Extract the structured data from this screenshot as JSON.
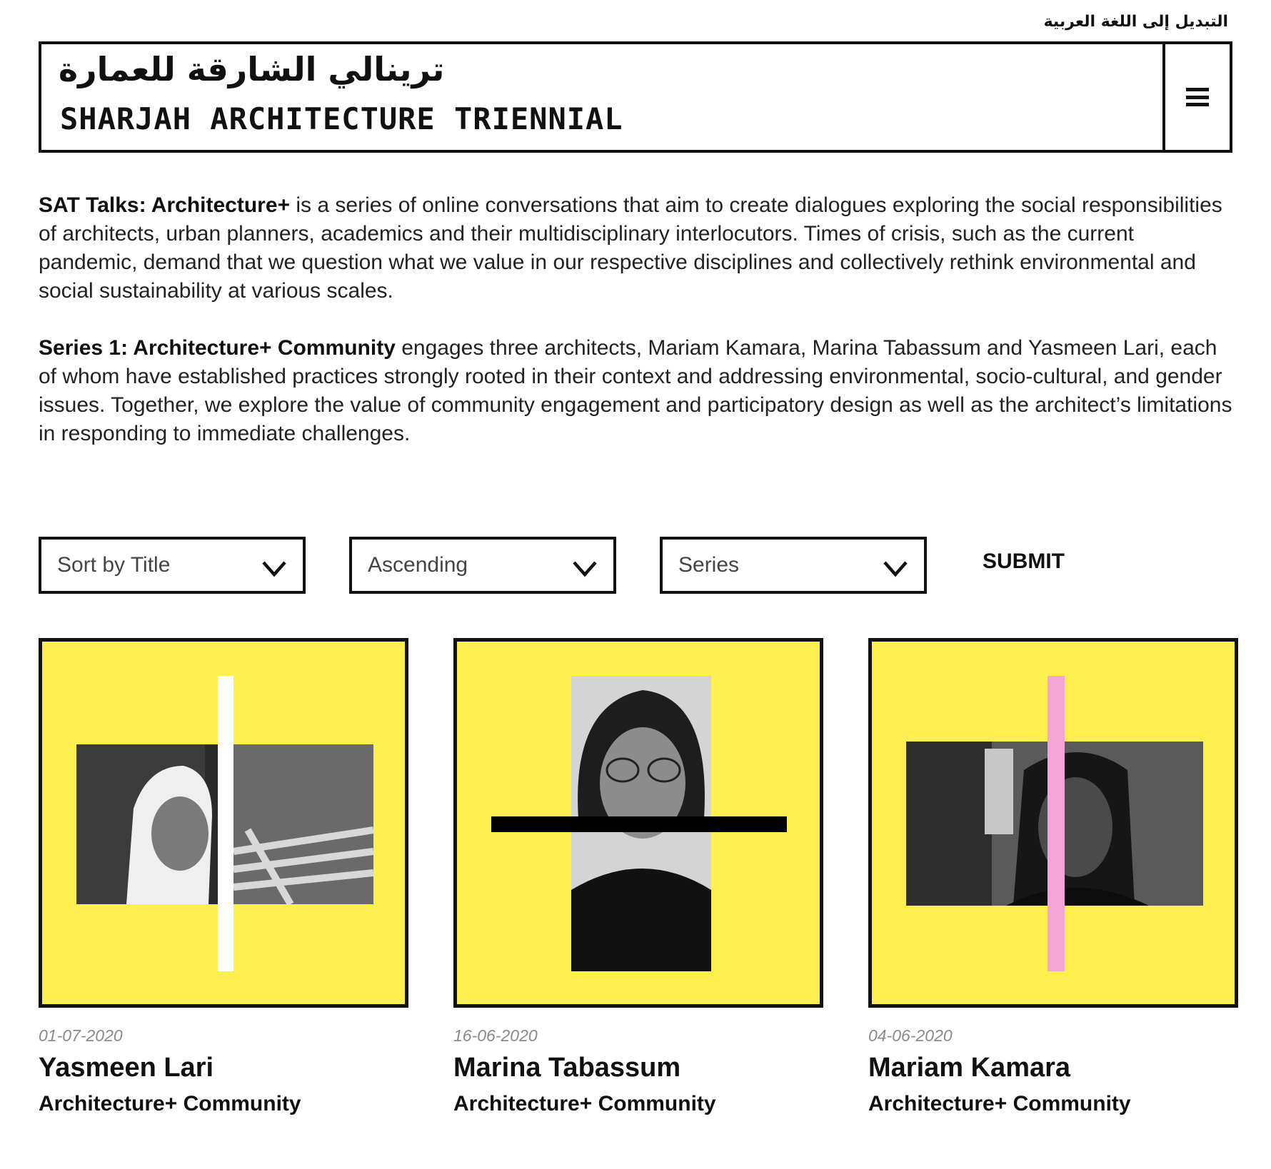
{
  "language_switch": "التبديل إلى اللغة العربية",
  "header": {
    "logo_arabic": "ترينالي الشارقة للعمارة",
    "logo_english": "SHARJAH ARCHITECTURE TRIENNIAL",
    "menu_icon": "hamburger-icon"
  },
  "intro": {
    "p1_bold": "SAT Talks: Architecture+",
    "p1_text": " is a series of online conversations that aim to create dialogues exploring the social responsibilities of architects, urban planners, academics and their multidisciplinary interlocutors. Times of crisis, such as the current pandemic, demand that we question what we value in our respective disciplines and collectively rethink environmental and social sustainability at various scales.",
    "p2_bold": "Series 1: Architecture+ Community",
    "p2_text": " engages three architects, Mariam Kamara, Marina Tabassum and Yasmeen Lari, each of whom have established practices strongly rooted in their context and addressing environmental, socio-cultural, and gender issues. Together, we explore the value of community engagement and participatory design as well as the architect’s limitations in responding to immediate challenges."
  },
  "filters": {
    "sort_by": "Sort by Title",
    "order": "Ascending",
    "series": "Series",
    "submit": "SUBMIT"
  },
  "cards": [
    {
      "date": "01-07-2020",
      "name": "Yasmeen Lari",
      "series": "Architecture+ Community",
      "accent_color": "#ffffff"
    },
    {
      "date": "16-06-2020",
      "name": "Marina Tabassum",
      "series": "Architecture+ Community",
      "accent_color": "#000000"
    },
    {
      "date": "04-06-2020",
      "name": "Mariam Kamara",
      "series": "Architecture+ Community",
      "accent_color": "#f2a5d6"
    }
  ],
  "colors": {
    "tile_background": "#fdf04e",
    "border": "#111111"
  }
}
